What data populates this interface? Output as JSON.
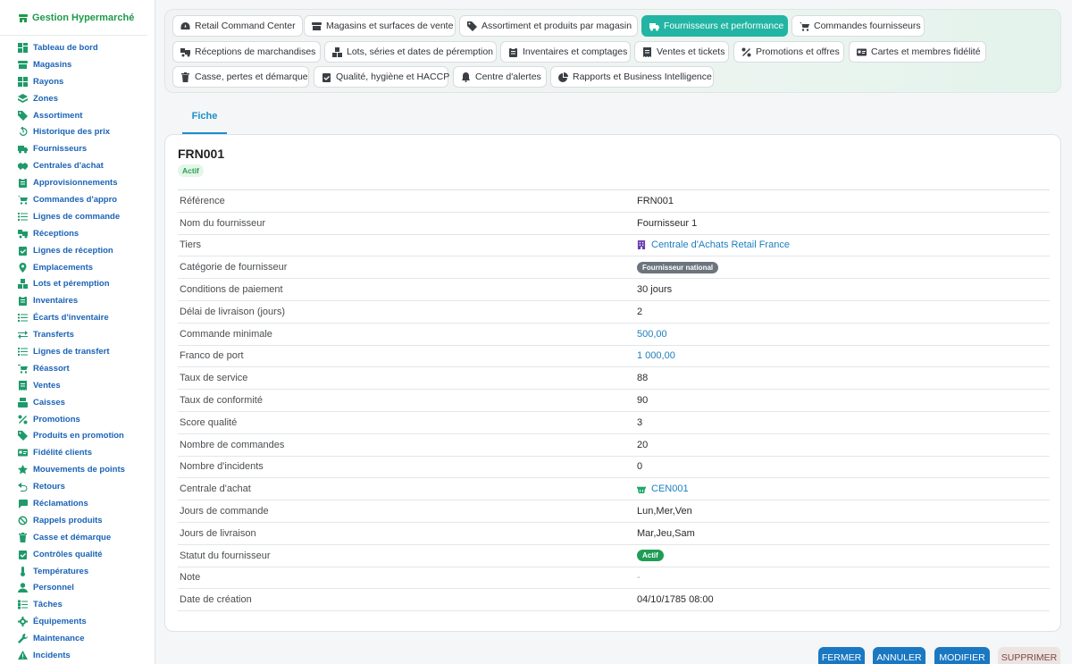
{
  "app": {
    "title": "Gestion Hypermarché"
  },
  "sidebar": {
    "items": [
      {
        "label": "Tableau de bord",
        "icon": "dashboard-icon"
      },
      {
        "label": "Magasins",
        "icon": "store-icon"
      },
      {
        "label": "Rayons",
        "icon": "grid-icon"
      },
      {
        "label": "Zones",
        "icon": "layers-icon"
      },
      {
        "label": "Assortiment",
        "icon": "tags-icon"
      },
      {
        "label": "Historique des prix",
        "icon": "history-icon"
      },
      {
        "label": "Fournisseurs",
        "icon": "truck-icon"
      },
      {
        "label": "Centrales d'achat",
        "icon": "handshake-icon"
      },
      {
        "label": "Approvisionnements",
        "icon": "clipboard-icon"
      },
      {
        "label": "Commandes d'appro",
        "icon": "cart-icon"
      },
      {
        "label": "Lignes de commande",
        "icon": "list-icon"
      },
      {
        "label": "Réceptions",
        "icon": "truck-loading-icon"
      },
      {
        "label": "Lignes de réception",
        "icon": "clipboard-check-icon"
      },
      {
        "label": "Emplacements",
        "icon": "location-icon"
      },
      {
        "label": "Lots et péremption",
        "icon": "boxes-icon"
      },
      {
        "label": "Inventaires",
        "icon": "clipboard-icon"
      },
      {
        "label": "Écarts d'inventaire",
        "icon": "list-icon"
      },
      {
        "label": "Transferts",
        "icon": "exchange-icon"
      },
      {
        "label": "Lignes de transfert",
        "icon": "list-icon"
      },
      {
        "label": "Réassort",
        "icon": "cart-plus-icon"
      },
      {
        "label": "Ventes",
        "icon": "receipt-icon"
      },
      {
        "label": "Caisses",
        "icon": "cash-register-icon"
      },
      {
        "label": "Promotions",
        "icon": "percent-icon"
      },
      {
        "label": "Produits en promotion",
        "icon": "tag-icon"
      },
      {
        "label": "Fidélité clients",
        "icon": "id-card-icon"
      },
      {
        "label": "Mouvements de points",
        "icon": "star-icon"
      },
      {
        "label": "Retours",
        "icon": "undo-icon"
      },
      {
        "label": "Réclamations",
        "icon": "comment-icon"
      },
      {
        "label": "Rappels produits",
        "icon": "ban-icon"
      },
      {
        "label": "Casse et démarque",
        "icon": "trash-icon"
      },
      {
        "label": "Contrôles qualité",
        "icon": "clipboard-check-icon"
      },
      {
        "label": "Températures",
        "icon": "thermometer-icon"
      },
      {
        "label": "Personnel",
        "icon": "user-icon"
      },
      {
        "label": "Tâches",
        "icon": "tasks-icon"
      },
      {
        "label": "Équipements",
        "icon": "cog-icon"
      },
      {
        "label": "Maintenance",
        "icon": "wrench-icon"
      },
      {
        "label": "Incidents",
        "icon": "warning-icon"
      }
    ]
  },
  "topnav": {
    "chips": [
      {
        "label": "Retail Command Center",
        "icon": "gauge-icon",
        "active": false
      },
      {
        "label": "Magasins et surfaces de vente",
        "icon": "store-icon",
        "active": false
      },
      {
        "label": "Assortiment et produits par magasin",
        "icon": "tags-icon",
        "active": false
      },
      {
        "label": "Fournisseurs et performance",
        "icon": "truck-icon",
        "active": true
      },
      {
        "label": "Commandes fournisseurs",
        "icon": "cart-icon",
        "active": false
      },
      {
        "label": "Réceptions de marchandises",
        "icon": "truck-loading-icon",
        "active": false
      },
      {
        "label": "Lots, séries et dates de péremption",
        "icon": "boxes-icon",
        "active": false
      },
      {
        "label": "Inventaires et comptages",
        "icon": "clipboard-icon",
        "active": false
      },
      {
        "label": "Ventes et tickets",
        "icon": "receipt-icon",
        "active": false
      },
      {
        "label": "Promotions et offres",
        "icon": "percent-icon",
        "active": false
      },
      {
        "label": "Cartes et membres fidélité",
        "icon": "id-card-icon",
        "active": false
      },
      {
        "label": "Casse, pertes et démarque",
        "icon": "trash-icon",
        "active": false
      },
      {
        "label": "Qualité, hygiène et HACCP",
        "icon": "clipboard-check-icon",
        "active": false
      },
      {
        "label": "Centre d'alertes",
        "icon": "bell-icon",
        "active": false
      },
      {
        "label": "Rapports et Business Intelligence",
        "icon": "chart-pie-icon",
        "active": false
      }
    ]
  },
  "tabs": [
    {
      "label": "Fiche"
    }
  ],
  "record": {
    "title": "FRN001",
    "status": "Actif",
    "fields": [
      {
        "key": "Référence",
        "value": "FRN001",
        "type": "text"
      },
      {
        "key": "Nom du fournisseur",
        "value": "Fournisseur 1",
        "type": "text"
      },
      {
        "key": "Tiers",
        "value": "Centrale d'Achats Retail France",
        "type": "link",
        "icon": "building-icon"
      },
      {
        "key": "Catégorie de fournisseur",
        "value": "Fournisseur national",
        "type": "badge-dark"
      },
      {
        "key": "Conditions de paiement",
        "value": "30 jours",
        "type": "text"
      },
      {
        "key": "Délai de livraison (jours)",
        "value": "2",
        "type": "text"
      },
      {
        "key": "Commande minimale",
        "value": "500,00",
        "type": "link"
      },
      {
        "key": "Franco de port",
        "value": "1 000,00",
        "type": "link"
      },
      {
        "key": "Taux de service",
        "value": "88",
        "type": "text"
      },
      {
        "key": "Taux de conformité",
        "value": "90",
        "type": "text"
      },
      {
        "key": "Score qualité",
        "value": "3",
        "type": "text"
      },
      {
        "key": "Nombre de commandes",
        "value": "20",
        "type": "text"
      },
      {
        "key": "Nombre d'incidents",
        "value": "0",
        "type": "text"
      },
      {
        "key": "Centrale d'achat",
        "value": "CEN001",
        "type": "link",
        "icon": "shopping-basket-icon"
      },
      {
        "key": "Jours de commande",
        "value": "Lun,Mer,Ven",
        "type": "text"
      },
      {
        "key": "Jours de livraison",
        "value": "Mar,Jeu,Sam",
        "type": "text"
      },
      {
        "key": "Statut du fournisseur",
        "value": "Actif",
        "type": "badge-green"
      },
      {
        "key": "Note",
        "value": "-",
        "type": "muted"
      },
      {
        "key": "Date de création",
        "value": "04/10/1785 08:00",
        "type": "text"
      }
    ]
  },
  "actions": {
    "close": "FERMER",
    "cancel": "ANNULER",
    "edit": "MODIFIER",
    "delete": "SUPPRIMER"
  },
  "colors": {
    "accent": "#23b5a3",
    "link": "#1c7fbf",
    "sidebar_link": "#1a63b6",
    "success": "#1f9d55",
    "primary_button": "#1a78c2"
  }
}
